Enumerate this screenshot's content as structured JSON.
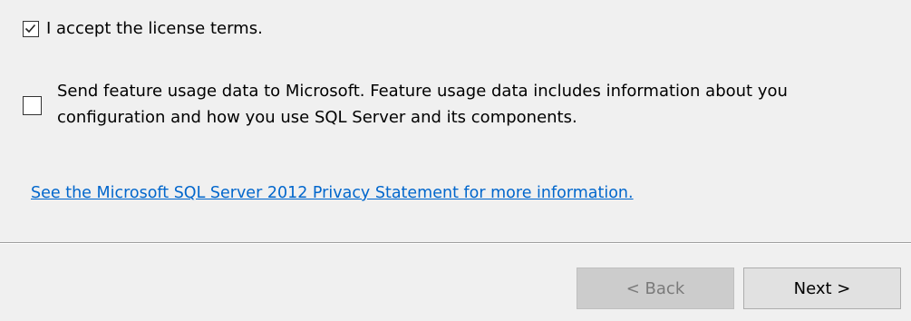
{
  "license": {
    "accept_checked": true,
    "accept_label": "I accept the license terms."
  },
  "usage": {
    "checked": false,
    "line1": "Send feature usage data to Microsoft. Feature usage data includes information about you",
    "line2": "configuration and how you use SQL Server and its components."
  },
  "privacy_link": "See the Microsoft SQL Server 2012 Privacy Statement for more information.",
  "buttons": {
    "back_label": "< Back",
    "back_enabled": false,
    "next_label": "Next >"
  },
  "colors": {
    "background": "#f0f0f0",
    "link": "#0066cc"
  }
}
